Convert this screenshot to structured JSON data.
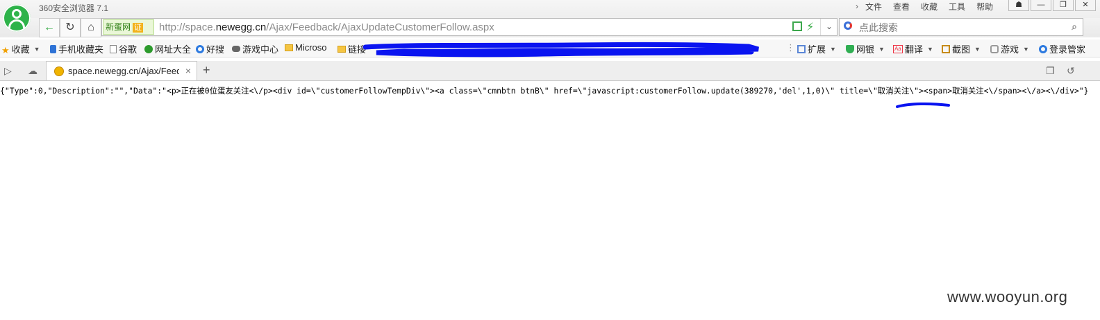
{
  "window": {
    "title": "360安全浏览器 7.1",
    "menu": [
      "文件",
      "查看",
      "收藏",
      "工具",
      "帮助"
    ],
    "controls": {
      "skin": "☗",
      "minimize": "—",
      "maximize": "❐",
      "close": "✕"
    }
  },
  "nav": {
    "site_badge": "新蛋网",
    "cert": "证",
    "url_prefix": "http://space.",
    "url_domain": "newegg.cn",
    "url_path": "/Ajax/Feedback/AjaxUpdateCustomerFollow.aspx",
    "search_placeholder": "点此搜索"
  },
  "favorites": {
    "items": [
      {
        "icon": "star-icon",
        "label": "收藏"
      },
      {
        "icon": "phone-icon",
        "label": "手机收藏夹"
      },
      {
        "icon": "page-icon",
        "label": "谷歌"
      },
      {
        "icon": "globe-icon",
        "label": "网址大全"
      },
      {
        "icon": "haosou-icon",
        "label": "好搜"
      },
      {
        "icon": "gamepad-icon",
        "label": "游戏中心"
      },
      {
        "icon": "folder-icon",
        "label": "Microso"
      },
      {
        "icon": "folder-icon",
        "label": "链接"
      }
    ],
    "tools": [
      {
        "icon": "extension-icon",
        "label": "扩展"
      },
      {
        "icon": "bank-shield-icon",
        "label": "网银"
      },
      {
        "icon": "translate-icon",
        "label": "翻译"
      },
      {
        "icon": "screenshot-icon",
        "label": "截图"
      },
      {
        "icon": "game-icon",
        "label": "游戏"
      },
      {
        "icon": "login-icon",
        "label": "登录管家"
      }
    ]
  },
  "tabs": {
    "active": {
      "title": "space.newegg.cn/Ajax/Feedb",
      "close": "×"
    },
    "new_tab": "+"
  },
  "content": {
    "text": "{\"Type\":0,\"Description\":\"\",\"Data\":\"<p>正在被0位蛋友关注<\\/p><div id=\\\"customerFollowTempDiv\\\"><a class=\\\"cmnbtn btnB\\\" href=\\\"javascript:customerFollow.update(389270,'del',1,0)\\\" title=\\\"取消关注\\\"><span>取消关注<\\/span><\\/a><\\/div>\"}"
  },
  "watermark": "www.wooyun.org",
  "colors": {
    "accent_green": "#2eb34a",
    "redaction_blue": "#0a14f0"
  }
}
